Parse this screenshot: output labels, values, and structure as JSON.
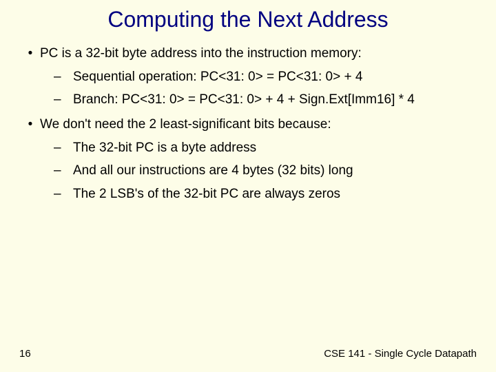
{
  "title": "Computing the Next Address",
  "bullets": [
    {
      "text": "PC is a 32-bit byte address into the instruction memory:",
      "subs": [
        "Sequential operation: PC<31: 0> = PC<31: 0> + 4",
        "Branch: PC<31: 0> = PC<31: 0> + 4 + Sign.Ext[Imm16] * 4"
      ]
    },
    {
      "text": "We don't need the 2 least-significant bits  because:",
      "subs": [
        "The 32-bit PC is a byte address",
        "And all our instructions are 4 bytes (32 bits) long",
        "The 2 LSB's of the 32-bit PC are always zeros"
      ]
    }
  ],
  "footer": {
    "page": "16",
    "course": "CSE 141 - Single Cycle Datapath"
  }
}
